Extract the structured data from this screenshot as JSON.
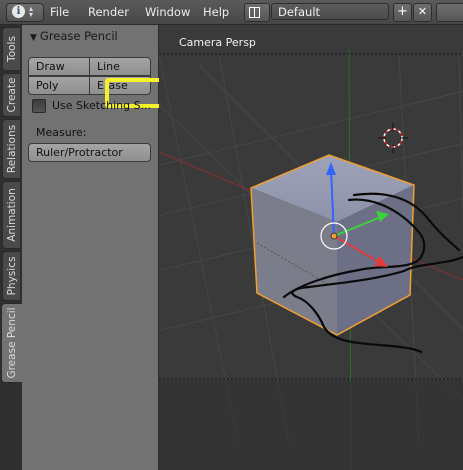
{
  "header": {
    "info_icon": "info-icon",
    "menus": [
      "File",
      "Render",
      "Window",
      "Help"
    ],
    "layout_name": "Default",
    "add_symbol": "+",
    "close_symbol": "✕"
  },
  "tabs": [
    "Tools",
    "Create",
    "Relations",
    "Animation",
    "Physics",
    "Grease Pencil"
  ],
  "active_tab": "Grease Pencil",
  "panel": {
    "title": "Grease Pencil",
    "draw_label": "Draw",
    "line_label": "Line",
    "poly_label": "Poly",
    "erase_label": "Erase",
    "sketching_label": "Use Sketching S...",
    "sketching_checked": false,
    "measure_label": "Measure:",
    "ruler_label": "Ruler/Protractor"
  },
  "viewport": {
    "view_name": "Camera Persp"
  },
  "colors": {
    "highlight": "#f5f227",
    "selection": "#f0a030",
    "axis_x": "#e03c3c",
    "axis_y": "#3cd23c",
    "axis_z": "#3264ff"
  }
}
